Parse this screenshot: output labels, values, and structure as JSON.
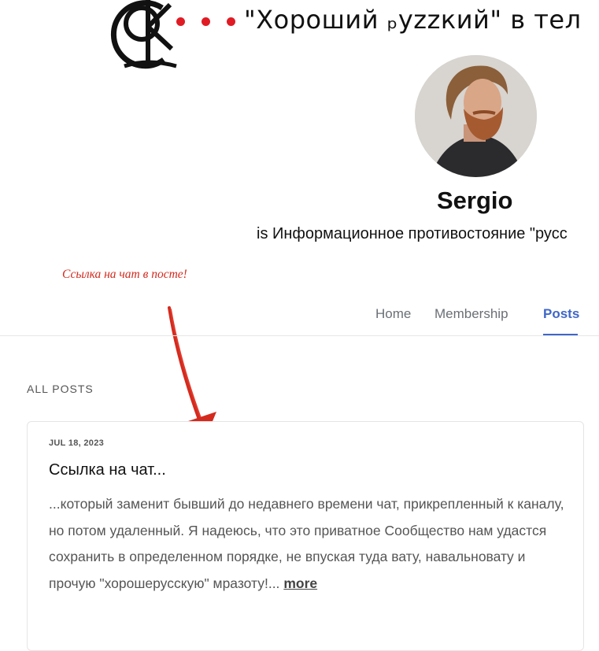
{
  "banner": {
    "title": "\"Хороший ₚуzzкий\" в тел",
    "logo_icon": "ok-monogram-logo",
    "dot_color": "#e01b24"
  },
  "creator": {
    "name": "Sergio",
    "tagline": "is Информационное противостояние \"русс"
  },
  "annotation": {
    "text": "Ссылка на чат в посте!",
    "color": "#d42a1e"
  },
  "nav": {
    "tabs": [
      {
        "label": "Home"
      },
      {
        "label": "Membership"
      },
      {
        "label": "Posts"
      }
    ],
    "active_color": "#3f67c9"
  },
  "posts_section": {
    "heading": "ALL POSTS"
  },
  "post": {
    "date": "JUL 18, 2023",
    "title": "Ссылка на чат...",
    "excerpt": "...который заменит бывший до недавнего времени чат, прикрепленный к каналу, но потом удаленный. Я надеюсь, что это приватное Сообщество нам удастся сохранить в определенном порядке, не впуская туда вату, навальноватy и прочую \"хорошерусскую\" мразоту!...",
    "more_label": "more"
  }
}
